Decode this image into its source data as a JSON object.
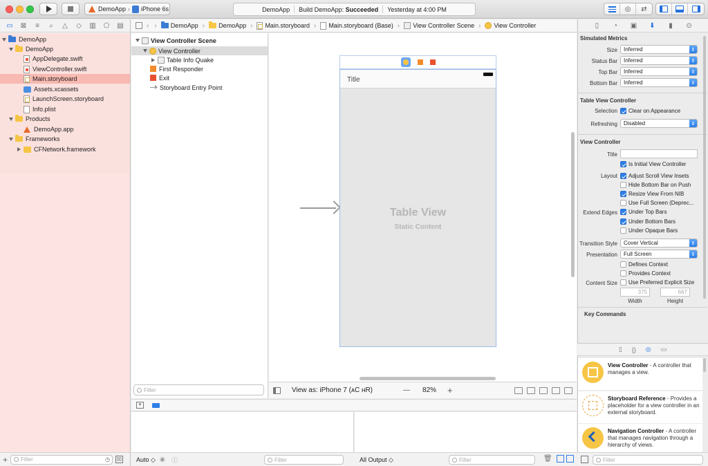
{
  "toolbar": {
    "scheme_app": "DemoApp",
    "scheme_device": "iPhone 6s",
    "status_app": "DemoApp",
    "status_build_prefix": "Build DemoApp:",
    "status_build_result": "Succeeded",
    "status_time": "Yesterday at 4:00 PM"
  },
  "navigator": {
    "tree": [
      {
        "label": "DemoApp",
        "icon": "project-icon"
      },
      {
        "label": "DemoApp",
        "icon": "folder-icon"
      },
      {
        "label": "AppDelegate.swift",
        "icon": "swift-file-icon"
      },
      {
        "label": "ViewController.swift",
        "icon": "swift-file-icon"
      },
      {
        "label": "Main.storyboard",
        "icon": "storyboard-file-icon",
        "selected": true
      },
      {
        "label": "Assets.xcassets",
        "icon": "asset-catalog-icon"
      },
      {
        "label": "LaunchScreen.storyboard",
        "icon": "storyboard-file-icon"
      },
      {
        "label": "Info.plist",
        "icon": "plist-file-icon"
      },
      {
        "label": "Products",
        "icon": "folder-icon"
      },
      {
        "label": "DemoApp.app",
        "icon": "app-icon"
      },
      {
        "label": "Frameworks",
        "icon": "folder-icon"
      },
      {
        "label": "CFNetwork.framework",
        "icon": "framework-icon"
      }
    ],
    "filter_placeholder": "Filter"
  },
  "jumpbar": {
    "items": [
      "DemoApp",
      "DemoApp",
      "Main.storyboard",
      "Main.storyboard (Base)",
      "View Controller Scene",
      "View Controller"
    ]
  },
  "outline": {
    "scene": "View Controller Scene",
    "items": [
      "View Controller",
      "Table Info Quake",
      "First Responder",
      "Exit",
      "Storyboard Entry Point"
    ],
    "filter_placeholder": "Filter"
  },
  "canvas": {
    "nav_title": "Title",
    "table_view_title": "Table View",
    "table_view_subtitle": "Static Content"
  },
  "canvas_bar": {
    "view_as": "View as: iPhone 7 (ᴀC ʜR)",
    "zoom": "82%",
    "minus": "—",
    "plus": "+"
  },
  "debug": {
    "auto_label": "Auto ◇",
    "filter_placeholder": "Filter",
    "all_output": "All Output ◇"
  },
  "inspector": {
    "simulated_metrics": {
      "heading": "Simulated Metrics",
      "size_label": "Size",
      "size_value": "Inferred",
      "status_bar_label": "Status Bar",
      "status_bar_value": "Inferred",
      "top_bar_label": "Top Bar",
      "top_bar_value": "Inferred",
      "bottom_bar_label": "Bottom Bar",
      "bottom_bar_value": "Inferred"
    },
    "table_view_controller": {
      "heading": "Table View Controller",
      "selection_label": "Selection",
      "selection_value": "Clear on Appearance",
      "refreshing_label": "Refreshing",
      "refreshing_value": "Disabled"
    },
    "view_controller": {
      "heading": "View Controller",
      "title_label": "Title",
      "is_initial": "Is Initial View Controller",
      "layout_label": "Layout",
      "adjust_scroll": "Adjust Scroll View Insets",
      "hide_bottom": "Hide Bottom Bar on Push",
      "resize_nib": "Resize View From NIB",
      "full_screen": "Use Full Screen (Deprec...",
      "extend_edges_label": "Extend Edges",
      "under_top": "Under Top Bars",
      "under_bottom": "Under Bottom Bars",
      "under_opaque": "Under Opaque Bars",
      "transition_label": "Transition Style",
      "transition_value": "Cover Vertical",
      "presentation_label": "Presentation",
      "presentation_value": "Full Screen",
      "defines_context": "Defines Context",
      "provides_context": "Provides Context",
      "content_size_label": "Content Size",
      "preferred_size": "Use Preferred Explicit Size",
      "width_value": "375",
      "height_value": "667",
      "width_label": "Width",
      "height_label": "Height"
    },
    "key_commands": "Key Commands"
  },
  "library": {
    "items": [
      {
        "title": "View Controller",
        "desc": " - A controller that manages a view."
      },
      {
        "title": "Storyboard Reference",
        "desc": " - Provides a placeholder for a view controller in an external storyboard."
      },
      {
        "title": "Navigation Controller",
        "desc": " - A controller that manages navigation through a hierarchy of views."
      }
    ],
    "filter_placeholder": "Filter"
  }
}
